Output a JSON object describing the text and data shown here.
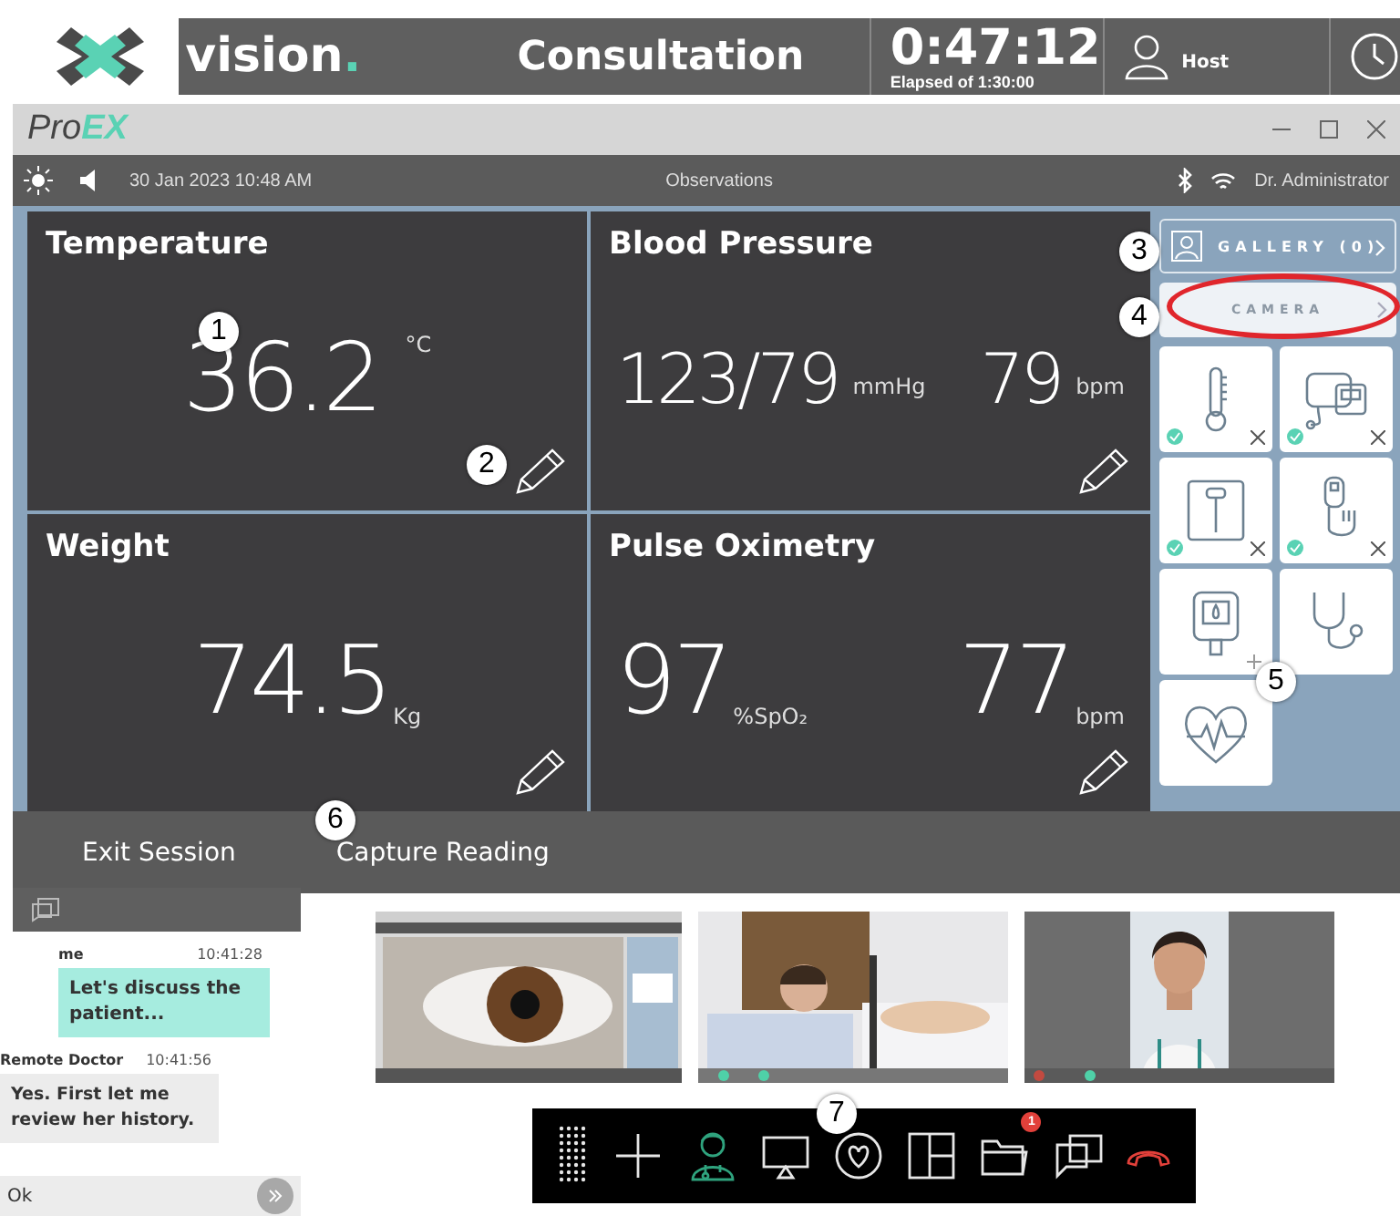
{
  "header": {
    "brand": "vision",
    "brand_dot": ".",
    "title": "Consultation",
    "timer": "0:47:12",
    "timer_caption": "Elapsed of 1:30:00",
    "user": "Host"
  },
  "window": {
    "title_main": "Pro",
    "title_accent": "EX"
  },
  "status_bar": {
    "date": "30 Jan 2023 10:48 AM",
    "title": "Observations",
    "user": "Dr. Administrator"
  },
  "vitals": [
    {
      "title": "Temperature",
      "kind": "temperature",
      "readings": [
        {
          "value": "36.2",
          "unit": "°C"
        }
      ],
      "callout": "1",
      "edit_callout": "2"
    },
    {
      "title": "Blood Pressure",
      "kind": "blood_pressure",
      "readings": [
        {
          "value": "123/79",
          "unit": "mmHg"
        },
        {
          "value": "79",
          "unit": "bpm"
        }
      ]
    },
    {
      "title": "Weight",
      "kind": "weight",
      "readings": [
        {
          "value": "74.5",
          "unit": "Kg"
        }
      ]
    },
    {
      "title": "Pulse Oximetry",
      "kind": "pulse_oximetry",
      "readings": [
        {
          "value": "97",
          "unit": "%SpO₂"
        },
        {
          "value": "77",
          "unit": "bpm"
        }
      ]
    }
  ],
  "side_panel": {
    "gallery": {
      "label": "GALLERY (0)",
      "callout": "3"
    },
    "camera": {
      "label": "CAMERA",
      "callout": "4",
      "highlighted": true
    },
    "callout": "5",
    "devices": [
      {
        "kind": "thermometer",
        "connected": true,
        "addable": false
      },
      {
        "kind": "blood_pressure",
        "connected": true,
        "addable": false
      },
      {
        "kind": "scale",
        "connected": true,
        "addable": false
      },
      {
        "kind": "oximeter",
        "connected": true,
        "addable": false
      },
      {
        "kind": "glucometer",
        "connected": false,
        "addable": true
      },
      {
        "kind": "stethoscope",
        "connected": false,
        "addable": false
      },
      {
        "kind": "ecg",
        "connected": false,
        "addable": false
      }
    ]
  },
  "actions": [
    {
      "label": "Exit Session"
    },
    {
      "label": "Capture Reading",
      "callout": "6"
    }
  ],
  "chat": {
    "messages": [
      {
        "sender": "me",
        "time": "10:41:28",
        "text": "Let's discuss the patient...",
        "mine": true
      },
      {
        "sender": "Remote Doctor",
        "time": "10:41:56",
        "text": "Yes. First let me review her history.",
        "mine": false
      }
    ],
    "input": {
      "value": "Ok"
    }
  },
  "toolbar": {
    "callout": "7",
    "buttons": [
      {
        "kind": "grid",
        "active": false
      },
      {
        "kind": "add",
        "active": false
      },
      {
        "kind": "doctor",
        "active": true
      },
      {
        "kind": "screen_share",
        "active": false
      },
      {
        "kind": "heart",
        "active": false
      },
      {
        "kind": "layout",
        "active": false
      },
      {
        "kind": "folder",
        "active": false,
        "badge": "1"
      },
      {
        "kind": "chat",
        "active": false
      },
      {
        "kind": "hangup",
        "active": false
      }
    ]
  }
}
